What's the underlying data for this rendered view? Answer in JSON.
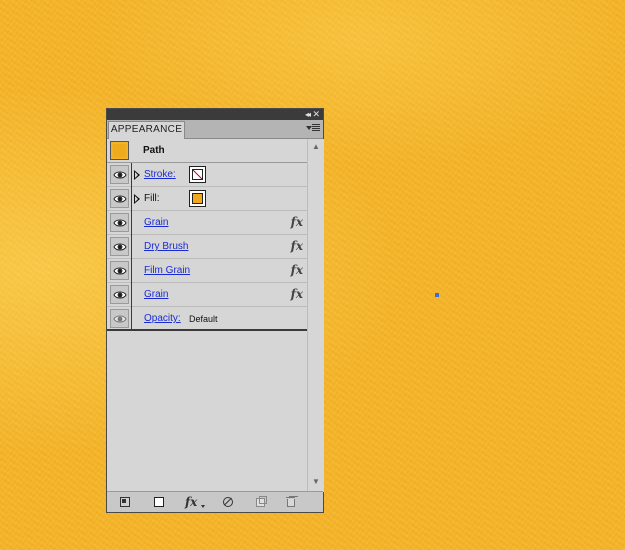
{
  "panel": {
    "tab_title": "APPEARANCE",
    "titlebar_collapse": "◂◂",
    "titlebar_close": "✕"
  },
  "header": {
    "label": "Path"
  },
  "rows": [
    {
      "label": "Stroke:",
      "link": true,
      "swatch": "stroke-none-swatch"
    },
    {
      "label": "Fill:",
      "link": false,
      "swatch": "fill-orange-swatch"
    },
    {
      "label": "Grain",
      "link": true,
      "fx": "fx"
    },
    {
      "label": "Dry Brush",
      "link": true,
      "fx": "fx"
    },
    {
      "label": "Film Grain",
      "link": true,
      "fx": "fx"
    },
    {
      "label": "Grain",
      "link": true,
      "fx": "fx"
    },
    {
      "label": "Opacity:",
      "link": true,
      "value": "Default"
    }
  ],
  "footer": {
    "fx_label": "fx"
  },
  "colors": {
    "canvas": "#f3b227",
    "fill_swatch": "#f0a91c",
    "link": "#1a2bd0",
    "stroke_none": "#c8102e"
  },
  "icons": [
    "eye-icon",
    "disclosure-triangle-icon",
    "fx-icon",
    "panel-menu-icon",
    "scroll-up-icon",
    "scroll-down-icon",
    "new-art-icon",
    "clear-appearance-icon",
    "add-effect-icon",
    "reduce-basic-icon",
    "duplicate-item-icon",
    "delete-item-icon"
  ]
}
